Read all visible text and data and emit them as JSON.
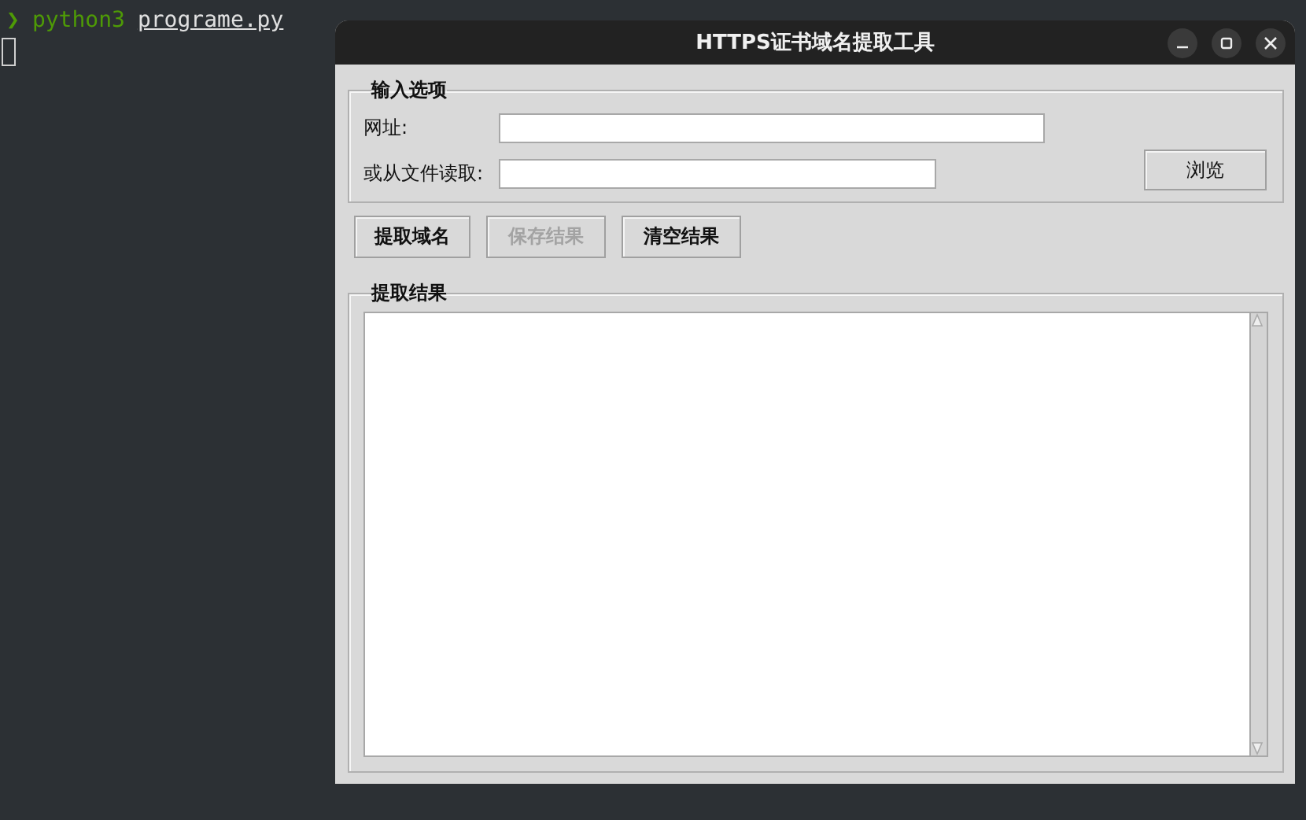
{
  "terminal": {
    "prompt": "❯",
    "command": "python3",
    "argument": "programe.py"
  },
  "window": {
    "title": "HTTPS证书域名提取工具"
  },
  "input_group": {
    "title": "输入选项",
    "url_label": "网址:",
    "file_label": "或从文件读取:",
    "browse_button": "浏览"
  },
  "actions": [
    {
      "label": "提取域名",
      "disabled": false
    },
    {
      "label": "保存结果",
      "disabled": true
    },
    {
      "label": "清空结果",
      "disabled": false
    }
  ],
  "results": {
    "title": "提取结果"
  }
}
